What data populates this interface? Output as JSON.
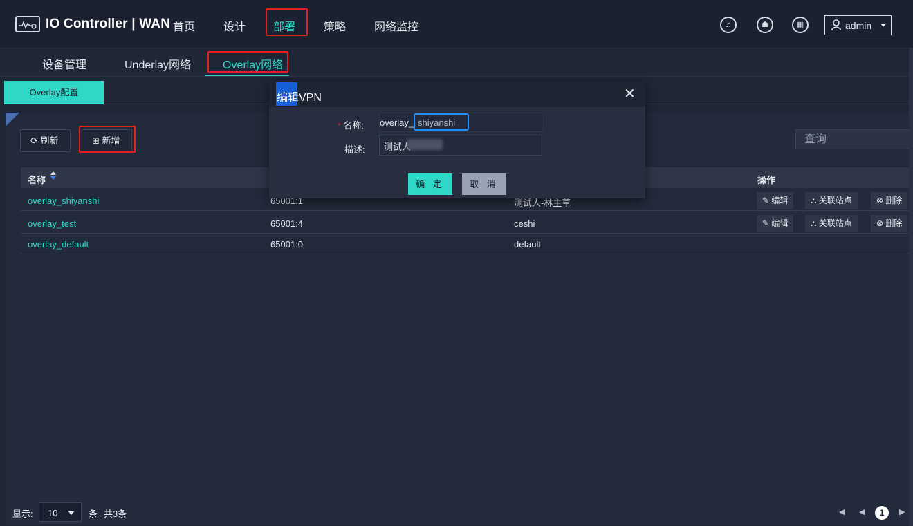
{
  "app": {
    "title": "IO Controller | WAN"
  },
  "nav": {
    "items": [
      "首页",
      "设计",
      "部署",
      "策略",
      "网络监控"
    ],
    "active": "部署"
  },
  "header": {
    "user": "admin"
  },
  "subnav": {
    "items": [
      "设备管理",
      "Underlay网络",
      "Overlay网络"
    ],
    "active": "Overlay网络"
  },
  "config_tab": {
    "label": "Overlay配置"
  },
  "toolbar": {
    "refresh_label": "刷新",
    "add_label": "新增",
    "search_placeholder": "查询"
  },
  "table": {
    "columns": [
      "名称",
      "操作"
    ],
    "rows": [
      {
        "name": "overlay_shiyanshi",
        "rd": "65001:1",
        "desc": "测试人-林主草",
        "actions": true
      },
      {
        "name": "overlay_test",
        "rd": "65001:4",
        "desc": "ceshi",
        "actions": true
      },
      {
        "name": "overlay_default",
        "rd": "65001:0",
        "desc": "default",
        "actions": false
      }
    ],
    "actions": {
      "edit": "编辑",
      "link_sites": "关联站点",
      "delete": "删除"
    }
  },
  "footer": {
    "show_label": "显示:",
    "page_size": "10",
    "unit": "条",
    "total": "共3条",
    "current_page": "1"
  },
  "modal": {
    "title_hl": "编辑",
    "title_rest": "VPN",
    "name_label": "名称:",
    "name_prefix": "overlay_",
    "name_value": "shiyanshi",
    "desc_label": "描述:",
    "desc_value": "测试人",
    "ok_label": "确 定",
    "cancel_label": "取 消"
  },
  "colors": {
    "accent": "#2fd7c7",
    "highlight": "#e3201e",
    "background": "#1f2636"
  }
}
